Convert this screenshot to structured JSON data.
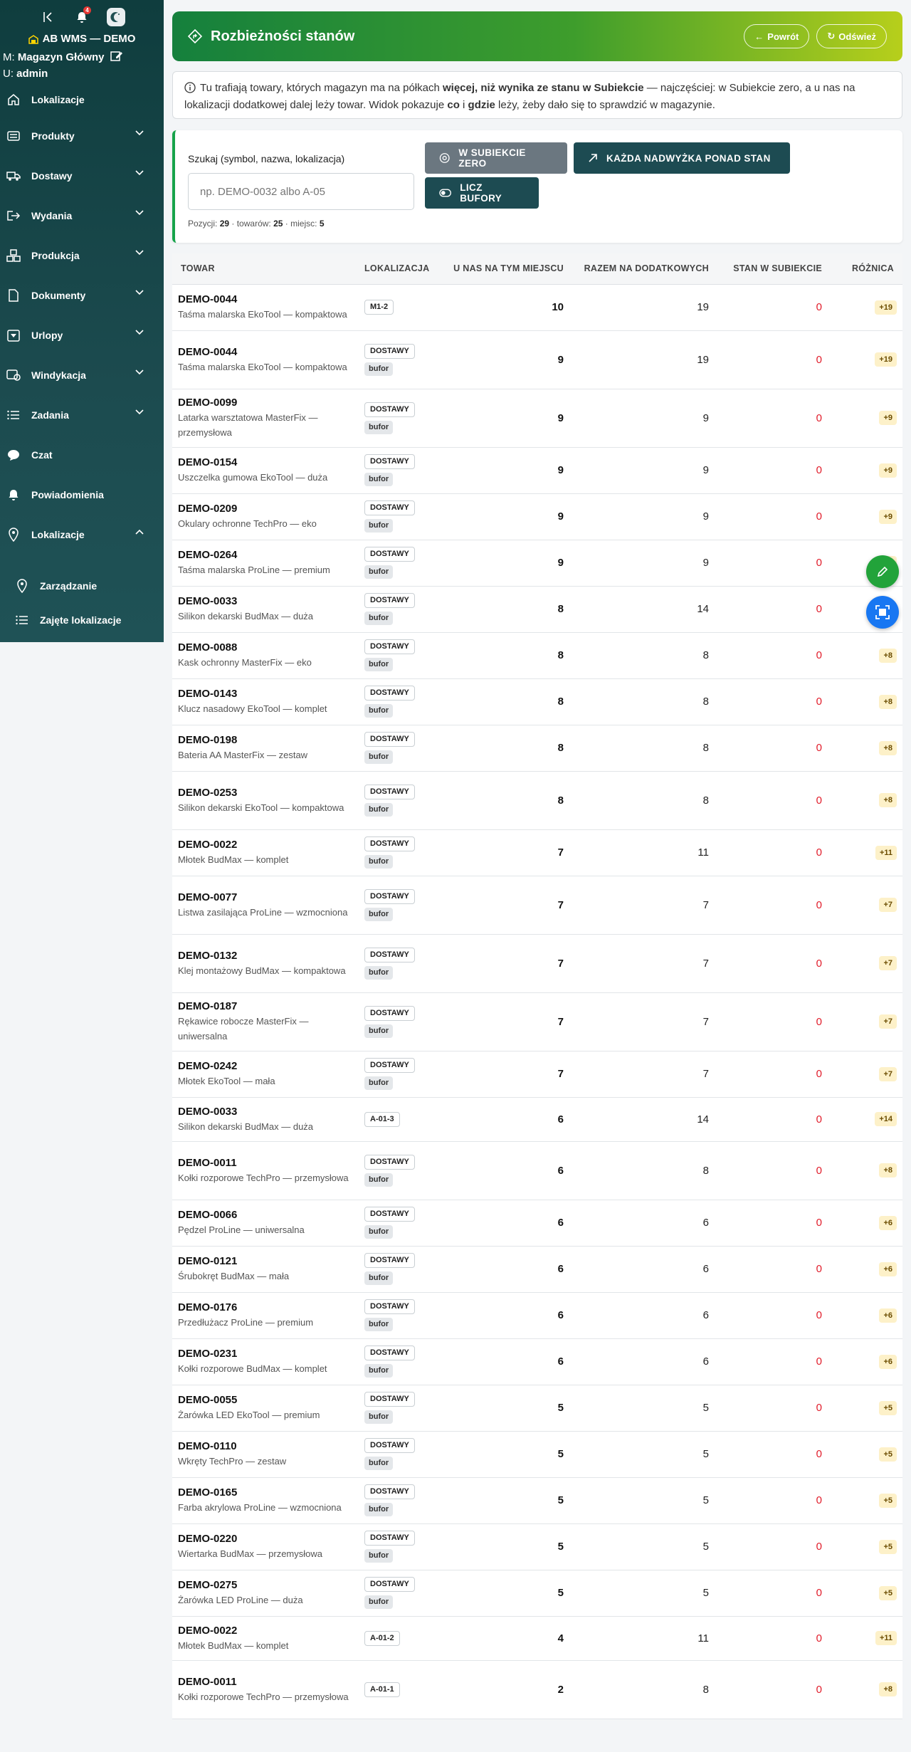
{
  "sidebar": {
    "notification_count": "4",
    "brand": "AB WMS — DEMO",
    "warehouse_prefix": "M:",
    "warehouse_value": "Magazyn Główny",
    "user_prefix": "U:",
    "user_value": "admin",
    "items": [
      {
        "label": "Lokalizacje",
        "icon": "home-icon"
      },
      {
        "label": "Produkty",
        "icon": "list-icon"
      },
      {
        "label": "Dostawy",
        "icon": "truck-icon"
      },
      {
        "label": "Wydania",
        "icon": "export-icon"
      },
      {
        "label": "Produkcja",
        "icon": "boxes-icon"
      },
      {
        "label": "Dokumenty",
        "icon": "document-icon"
      },
      {
        "label": "Urlopy",
        "icon": "vacation-icon"
      },
      {
        "label": "Windykacja",
        "icon": "collection-icon"
      },
      {
        "label": "Zadania",
        "icon": "tasks-icon"
      },
      {
        "label": "Czat",
        "icon": "chat-icon"
      },
      {
        "label": "Powiadomienia",
        "icon": "bell-icon"
      },
      {
        "label": "Lokalizacje",
        "icon": "pin-icon"
      }
    ],
    "sub_items": [
      {
        "label": "Zarządzanie"
      },
      {
        "label": "Zajęte lokalizacje"
      }
    ]
  },
  "header": {
    "title": "Rozbieżności stanów",
    "back_label": "Powrót",
    "refresh_label": "Odśwież"
  },
  "info": {
    "part1": "Tu trafiają towary, których magazyn ma na półkach ",
    "bold1": "więcej, niż wynika ze stanu w Subiekcie",
    "part2": " — najczęściej: w Subiekcie zero, a u nas na lokalizacji dodatkowej dalej leży towar. Widok pokazuje ",
    "bold2": "co",
    "part3": " i ",
    "bold3": "gdzie",
    "part4": " leży, żeby dało się to sprawdzić w magazynie."
  },
  "filter": {
    "search_label": "Szukaj (symbol, nazwa, lokalizacja)",
    "search_placeholder": "np. DEMO-0032 albo A-05",
    "btn_zero": "W SUBIEKCIE ZERO",
    "btn_surplus": "KAŻDA NADWYŻKA PONAD STAN",
    "btn_buffers": "LICZ BUFORY",
    "positions_label": "Pozycji:",
    "positions": "29",
    "goods_label": "towarów:",
    "goods": "25",
    "places_label": "miejsc:",
    "places": "5"
  },
  "table": {
    "headers": [
      "TOWAR",
      "LOKALIZACJA",
      "U NAS NA TYM MIEJSCU",
      "RAZEM NA DODATKOWYCH",
      "STAN W SUBIEKCIE",
      "RÓŻNICA"
    ],
    "rows": [
      {
        "sym": "DEMO-0044",
        "name": "Taśma malarska EkoTool — kompaktowa",
        "loc": "M1-2",
        "buf": "",
        "here": "10",
        "total": "19",
        "stock": "0",
        "diff": "+19"
      },
      {
        "sym": "DEMO-0044",
        "name": "Taśma malarska EkoTool — kompaktowa",
        "loc": "DOSTAWY",
        "buf": "bufor",
        "here": "9",
        "total": "19",
        "stock": "0",
        "diff": "+19"
      },
      {
        "sym": "DEMO-0099",
        "name": "Latarka warsztatowa MasterFix — przemysłowa",
        "loc": "DOSTAWY",
        "buf": "bufor",
        "here": "9",
        "total": "9",
        "stock": "0",
        "diff": "+9"
      },
      {
        "sym": "DEMO-0154",
        "name": "Uszczelka gumowa EkoTool — duża",
        "loc": "DOSTAWY",
        "buf": "bufor",
        "here": "9",
        "total": "9",
        "stock": "0",
        "diff": "+9"
      },
      {
        "sym": "DEMO-0209",
        "name": "Okulary ochronne TechPro — eko",
        "loc": "DOSTAWY",
        "buf": "bufor",
        "here": "9",
        "total": "9",
        "stock": "0",
        "diff": "+9"
      },
      {
        "sym": "DEMO-0264",
        "name": "Taśma malarska ProLine — premium",
        "loc": "DOSTAWY",
        "buf": "bufor",
        "here": "9",
        "total": "9",
        "stock": "0",
        "diff": "+9"
      },
      {
        "sym": "DEMO-0033",
        "name": "Silikon dekarski BudMax — duża",
        "loc": "DOSTAWY",
        "buf": "bufor",
        "here": "8",
        "total": "14",
        "stock": "0",
        "diff": "+14"
      },
      {
        "sym": "DEMO-0088",
        "name": "Kask ochronny MasterFix — eko",
        "loc": "DOSTAWY",
        "buf": "bufor",
        "here": "8",
        "total": "8",
        "stock": "0",
        "diff": "+8"
      },
      {
        "sym": "DEMO-0143",
        "name": "Klucz nasadowy EkoTool — komplet",
        "loc": "DOSTAWY",
        "buf": "bufor",
        "here": "8",
        "total": "8",
        "stock": "0",
        "diff": "+8"
      },
      {
        "sym": "DEMO-0198",
        "name": "Bateria AA MasterFix — zestaw",
        "loc": "DOSTAWY",
        "buf": "bufor",
        "here": "8",
        "total": "8",
        "stock": "0",
        "diff": "+8"
      },
      {
        "sym": "DEMO-0253",
        "name": "Silikon dekarski EkoTool — kompaktowa",
        "loc": "DOSTAWY",
        "buf": "bufor",
        "here": "8",
        "total": "8",
        "stock": "0",
        "diff": "+8"
      },
      {
        "sym": "DEMO-0022",
        "name": "Młotek BudMax — komplet",
        "loc": "DOSTAWY",
        "buf": "bufor",
        "here": "7",
        "total": "11",
        "stock": "0",
        "diff": "+11"
      },
      {
        "sym": "DEMO-0077",
        "name": "Listwa zasilająca ProLine — wzmocniona",
        "loc": "DOSTAWY",
        "buf": "bufor",
        "here": "7",
        "total": "7",
        "stock": "0",
        "diff": "+7"
      },
      {
        "sym": "DEMO-0132",
        "name": "Klej montażowy BudMax — kompaktowa",
        "loc": "DOSTAWY",
        "buf": "bufor",
        "here": "7",
        "total": "7",
        "stock": "0",
        "diff": "+7"
      },
      {
        "sym": "DEMO-0187",
        "name": "Rękawice robocze MasterFix — uniwersalna",
        "loc": "DOSTAWY",
        "buf": "bufor",
        "here": "7",
        "total": "7",
        "stock": "0",
        "diff": "+7"
      },
      {
        "sym": "DEMO-0242",
        "name": "Młotek EkoTool — mała",
        "loc": "DOSTAWY",
        "buf": "bufor",
        "here": "7",
        "total": "7",
        "stock": "0",
        "diff": "+7"
      },
      {
        "sym": "DEMO-0033",
        "name": "Silikon dekarski BudMax — duża",
        "loc": "A-01-3",
        "buf": "",
        "here": "6",
        "total": "14",
        "stock": "0",
        "diff": "+14"
      },
      {
        "sym": "DEMO-0011",
        "name": "Kołki rozporowe TechPro — przemysłowa",
        "loc": "DOSTAWY",
        "buf": "bufor",
        "here": "6",
        "total": "8",
        "stock": "0",
        "diff": "+8"
      },
      {
        "sym": "DEMO-0066",
        "name": "Pędzel ProLine — uniwersalna",
        "loc": "DOSTAWY",
        "buf": "bufor",
        "here": "6",
        "total": "6",
        "stock": "0",
        "diff": "+6"
      },
      {
        "sym": "DEMO-0121",
        "name": "Śrubokręt BudMax — mała",
        "loc": "DOSTAWY",
        "buf": "bufor",
        "here": "6",
        "total": "6",
        "stock": "0",
        "diff": "+6"
      },
      {
        "sym": "DEMO-0176",
        "name": "Przedłużacz ProLine — premium",
        "loc": "DOSTAWY",
        "buf": "bufor",
        "here": "6",
        "total": "6",
        "stock": "0",
        "diff": "+6"
      },
      {
        "sym": "DEMO-0231",
        "name": "Kołki rozporowe BudMax — komplet",
        "loc": "DOSTAWY",
        "buf": "bufor",
        "here": "6",
        "total": "6",
        "stock": "0",
        "diff": "+6"
      },
      {
        "sym": "DEMO-0055",
        "name": "Żarówka LED EkoTool — premium",
        "loc": "DOSTAWY",
        "buf": "bufor",
        "here": "5",
        "total": "5",
        "stock": "0",
        "diff": "+5"
      },
      {
        "sym": "DEMO-0110",
        "name": "Wkręty TechPro — zestaw",
        "loc": "DOSTAWY",
        "buf": "bufor",
        "here": "5",
        "total": "5",
        "stock": "0",
        "diff": "+5"
      },
      {
        "sym": "DEMO-0165",
        "name": "Farba akrylowa ProLine — wzmocniona",
        "loc": "DOSTAWY",
        "buf": "bufor",
        "here": "5",
        "total": "5",
        "stock": "0",
        "diff": "+5"
      },
      {
        "sym": "DEMO-0220",
        "name": "Wiertarka BudMax — przemysłowa",
        "loc": "DOSTAWY",
        "buf": "bufor",
        "here": "5",
        "total": "5",
        "stock": "0",
        "diff": "+5"
      },
      {
        "sym": "DEMO-0275",
        "name": "Żarówka LED ProLine — duża",
        "loc": "DOSTAWY",
        "buf": "bufor",
        "here": "5",
        "total": "5",
        "stock": "0",
        "diff": "+5"
      },
      {
        "sym": "DEMO-0022",
        "name": "Młotek BudMax — komplet",
        "loc": "A-01-2",
        "buf": "",
        "here": "4",
        "total": "11",
        "stock": "0",
        "diff": "+11"
      },
      {
        "sym": "DEMO-0011",
        "name": "Kołki rozporowe TechPro — przemysłowa",
        "loc": "A-01-1",
        "buf": "",
        "here": "2",
        "total": "8",
        "stock": "0",
        "diff": "+8"
      }
    ]
  },
  "colors": {
    "accent_green": "#16a34a",
    "sidebar": "#0f3d3e",
    "zero_red": "#e11d2b",
    "diff_badge": "#fdf1c9"
  }
}
